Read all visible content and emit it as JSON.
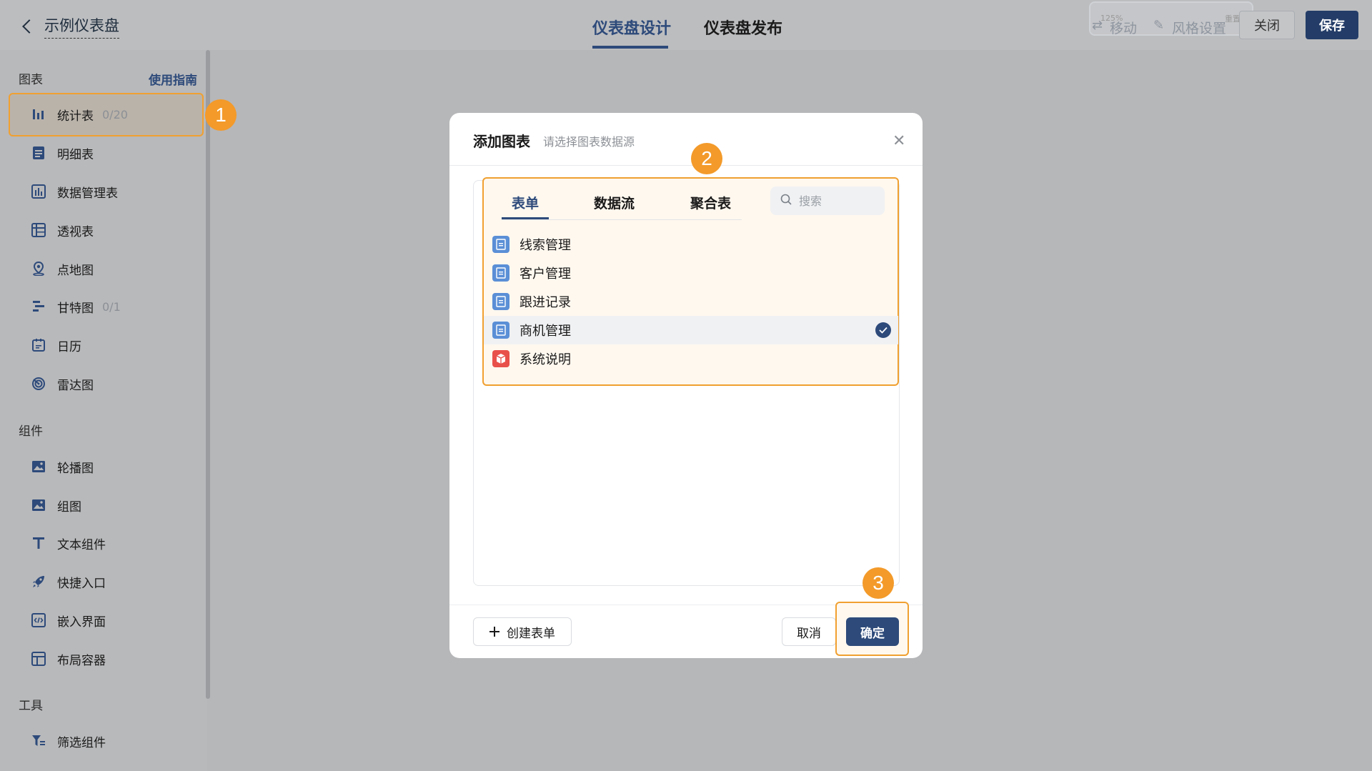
{
  "header": {
    "back_title": "示例仪表盘",
    "tabs": [
      {
        "label": "仪表盘设计"
      },
      {
        "label": "仪表盘发布"
      }
    ],
    "ghost_toolbar": {
      "zoom": "125%",
      "move": "移动",
      "style": "风格设置",
      "reset": "重置"
    },
    "close_label": "关闭",
    "save_label": "保存"
  },
  "sidebar": {
    "charts_section": "图表",
    "guide_link": "使用指南",
    "charts": [
      {
        "label": "统计表",
        "count": "0/20",
        "icon": "bar-chart-icon"
      },
      {
        "label": "明细表",
        "count": "",
        "icon": "detail-table-icon"
      },
      {
        "label": "数据管理表",
        "count": "",
        "icon": "data-manage-icon"
      },
      {
        "label": "透视表",
        "count": "",
        "icon": "pivot-table-icon"
      },
      {
        "label": "点地图",
        "count": "",
        "icon": "map-pin-icon"
      },
      {
        "label": "甘特图",
        "count": "0/1",
        "icon": "gantt-icon"
      },
      {
        "label": "日历",
        "count": "",
        "icon": "calendar-icon"
      },
      {
        "label": "雷达图",
        "count": "",
        "icon": "radar-icon"
      }
    ],
    "components_section": "组件",
    "components": [
      {
        "label": "轮播图",
        "icon": "image-icon"
      },
      {
        "label": "组图",
        "icon": "image-group-icon"
      },
      {
        "label": "文本组件",
        "icon": "text-icon"
      },
      {
        "label": "快捷入口",
        "icon": "rocket-icon"
      },
      {
        "label": "嵌入界面",
        "icon": "code-icon"
      },
      {
        "label": "布局容器",
        "icon": "layout-icon"
      }
    ],
    "tools_section": "工具",
    "tools": [
      {
        "label": "筛选组件",
        "icon": "filter-icon"
      }
    ]
  },
  "modal": {
    "title": "添加图表",
    "subtitle": "请选择图表数据源",
    "tabs": [
      {
        "label": "表单"
      },
      {
        "label": "数据流"
      },
      {
        "label": "聚合表"
      }
    ],
    "search_placeholder": "搜索",
    "items": [
      {
        "label": "线索管理",
        "type": "form",
        "selected": false
      },
      {
        "label": "客户管理",
        "type": "form",
        "selected": false
      },
      {
        "label": "跟进记录",
        "type": "form",
        "selected": false
      },
      {
        "label": "商机管理",
        "type": "form",
        "selected": true
      },
      {
        "label": "系统说明",
        "type": "app",
        "selected": false
      }
    ],
    "create_label": "创建表单",
    "cancel_label": "取消",
    "ok_label": "确定"
  },
  "annotations": {
    "step1": "1",
    "step2": "2",
    "step3": "3"
  },
  "colors": {
    "accent": "#2d4a7a",
    "highlight": "#f0a030",
    "badge": "#f39a2a",
    "app_icon": "#e8504a",
    "form_icon": "#5b8fd6"
  }
}
